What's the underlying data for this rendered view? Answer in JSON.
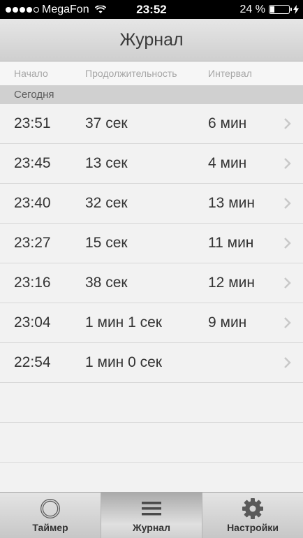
{
  "status_bar": {
    "carrier": "MegaFon",
    "time": "23:52",
    "battery_percent": "24 %",
    "battery_level": 0.24,
    "signal_bars_filled": 4,
    "signal_bars_total": 5
  },
  "header": {
    "title": "Журнал"
  },
  "columns": {
    "start": "Начало",
    "duration": "Продолжительность",
    "interval": "Интервал"
  },
  "section": {
    "label": "Сегодня"
  },
  "log": [
    {
      "start": "23:51",
      "duration": "37 сек",
      "interval": "6 мин"
    },
    {
      "start": "23:45",
      "duration": "13 сек",
      "interval": "4 мин"
    },
    {
      "start": "23:40",
      "duration": "32 сек",
      "interval": "13 мин"
    },
    {
      "start": "23:27",
      "duration": "15 сек",
      "interval": "11 мин"
    },
    {
      "start": "23:16",
      "duration": "38 сек",
      "interval": "12 мин"
    },
    {
      "start": "23:04",
      "duration": "1 мин 1 сек",
      "interval": "9 мин"
    },
    {
      "start": "22:54",
      "duration": "1 мин 0 сек",
      "interval": ""
    }
  ],
  "tabs": [
    {
      "label": "Таймер",
      "icon": "timer-ring-icon"
    },
    {
      "label": "Журнал",
      "icon": "list-icon",
      "active": true
    },
    {
      "label": "Настройки",
      "icon": "gear-icon"
    }
  ],
  "colors": {
    "section_bg": "#d0d0d0",
    "text": "#333333",
    "muted": "#a6a6a6"
  }
}
